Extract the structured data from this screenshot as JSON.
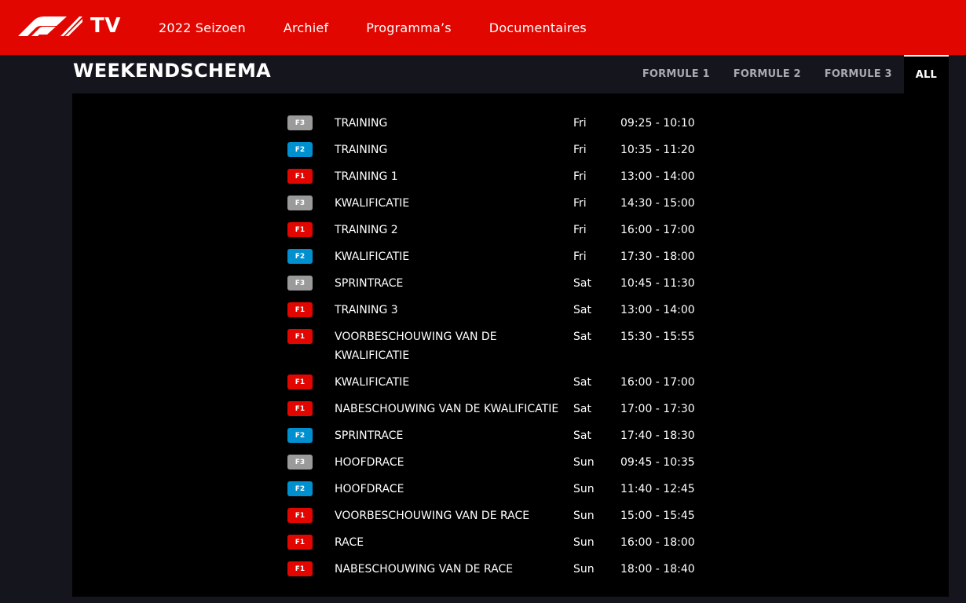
{
  "header": {
    "brand": "TV",
    "nav": [
      {
        "label": "2022 Seizoen"
      },
      {
        "label": "Archief"
      },
      {
        "label": "Programma’s"
      },
      {
        "label": "Documentaires"
      }
    ]
  },
  "section": {
    "title": "WEEKENDSCHEMA",
    "filters": [
      {
        "label": "FORMULE 1",
        "active": false
      },
      {
        "label": "FORMULE 2",
        "active": false
      },
      {
        "label": "FORMULE 3",
        "active": false
      },
      {
        "label": "ALL",
        "active": true
      }
    ]
  },
  "schedule": [
    {
      "series": "F3",
      "session": "TRAINING",
      "day": "Fri",
      "time": "09:25 - 10:10"
    },
    {
      "series": "F2",
      "session": "TRAINING",
      "day": "Fri",
      "time": "10:35 - 11:20"
    },
    {
      "series": "F1",
      "session": "TRAINING 1",
      "day": "Fri",
      "time": "13:00 - 14:00"
    },
    {
      "series": "F3",
      "session": "KWALIFICATIE",
      "day": "Fri",
      "time": "14:30 - 15:00"
    },
    {
      "series": "F1",
      "session": "TRAINING 2",
      "day": "Fri",
      "time": "16:00 - 17:00"
    },
    {
      "series": "F2",
      "session": "KWALIFICATIE",
      "day": "Fri",
      "time": "17:30 - 18:00"
    },
    {
      "series": "F3",
      "session": "SPRINTRACE",
      "day": "Sat",
      "time": "10:45 - 11:30"
    },
    {
      "series": "F1",
      "session": "TRAINING 3",
      "day": "Sat",
      "time": "13:00 - 14:00"
    },
    {
      "series": "F1",
      "session": "VOORBESCHOUWING VAN DE KWALIFICATIE",
      "day": "Sat",
      "time": "15:30 - 15:55"
    },
    {
      "series": "F1",
      "session": "KWALIFICATIE",
      "day": "Sat",
      "time": "16:00 - 17:00"
    },
    {
      "series": "F1",
      "session": "NABESCHOUWING VAN DE KWALIFICATIE",
      "day": "Sat",
      "time": "17:00 - 17:30"
    },
    {
      "series": "F2",
      "session": "SPRINTRACE",
      "day": "Sat",
      "time": "17:40 - 18:30"
    },
    {
      "series": "F3",
      "session": "HOOFDRACE",
      "day": "Sun",
      "time": "09:45 - 10:35"
    },
    {
      "series": "F2",
      "session": "HOOFDRACE",
      "day": "Sun",
      "time": "11:40 - 12:45"
    },
    {
      "series": "F1",
      "session": "VOORBESCHOUWING VAN DE RACE",
      "day": "Sun",
      "time": "15:00 - 15:45"
    },
    {
      "series": "F1",
      "session": "RACE",
      "day": "Sun",
      "time": "16:00 - 18:00"
    },
    {
      "series": "F1",
      "session": "NABESCHOUWING VAN DE RACE",
      "day": "Sun",
      "time": "18:00 - 18:40"
    }
  ],
  "colors": {
    "brand_red": "#e10600",
    "f1": "#e10600",
    "f2": "#0090d0",
    "f3": "#9a9a9a",
    "background": "#15151e",
    "panel": "#000000"
  }
}
